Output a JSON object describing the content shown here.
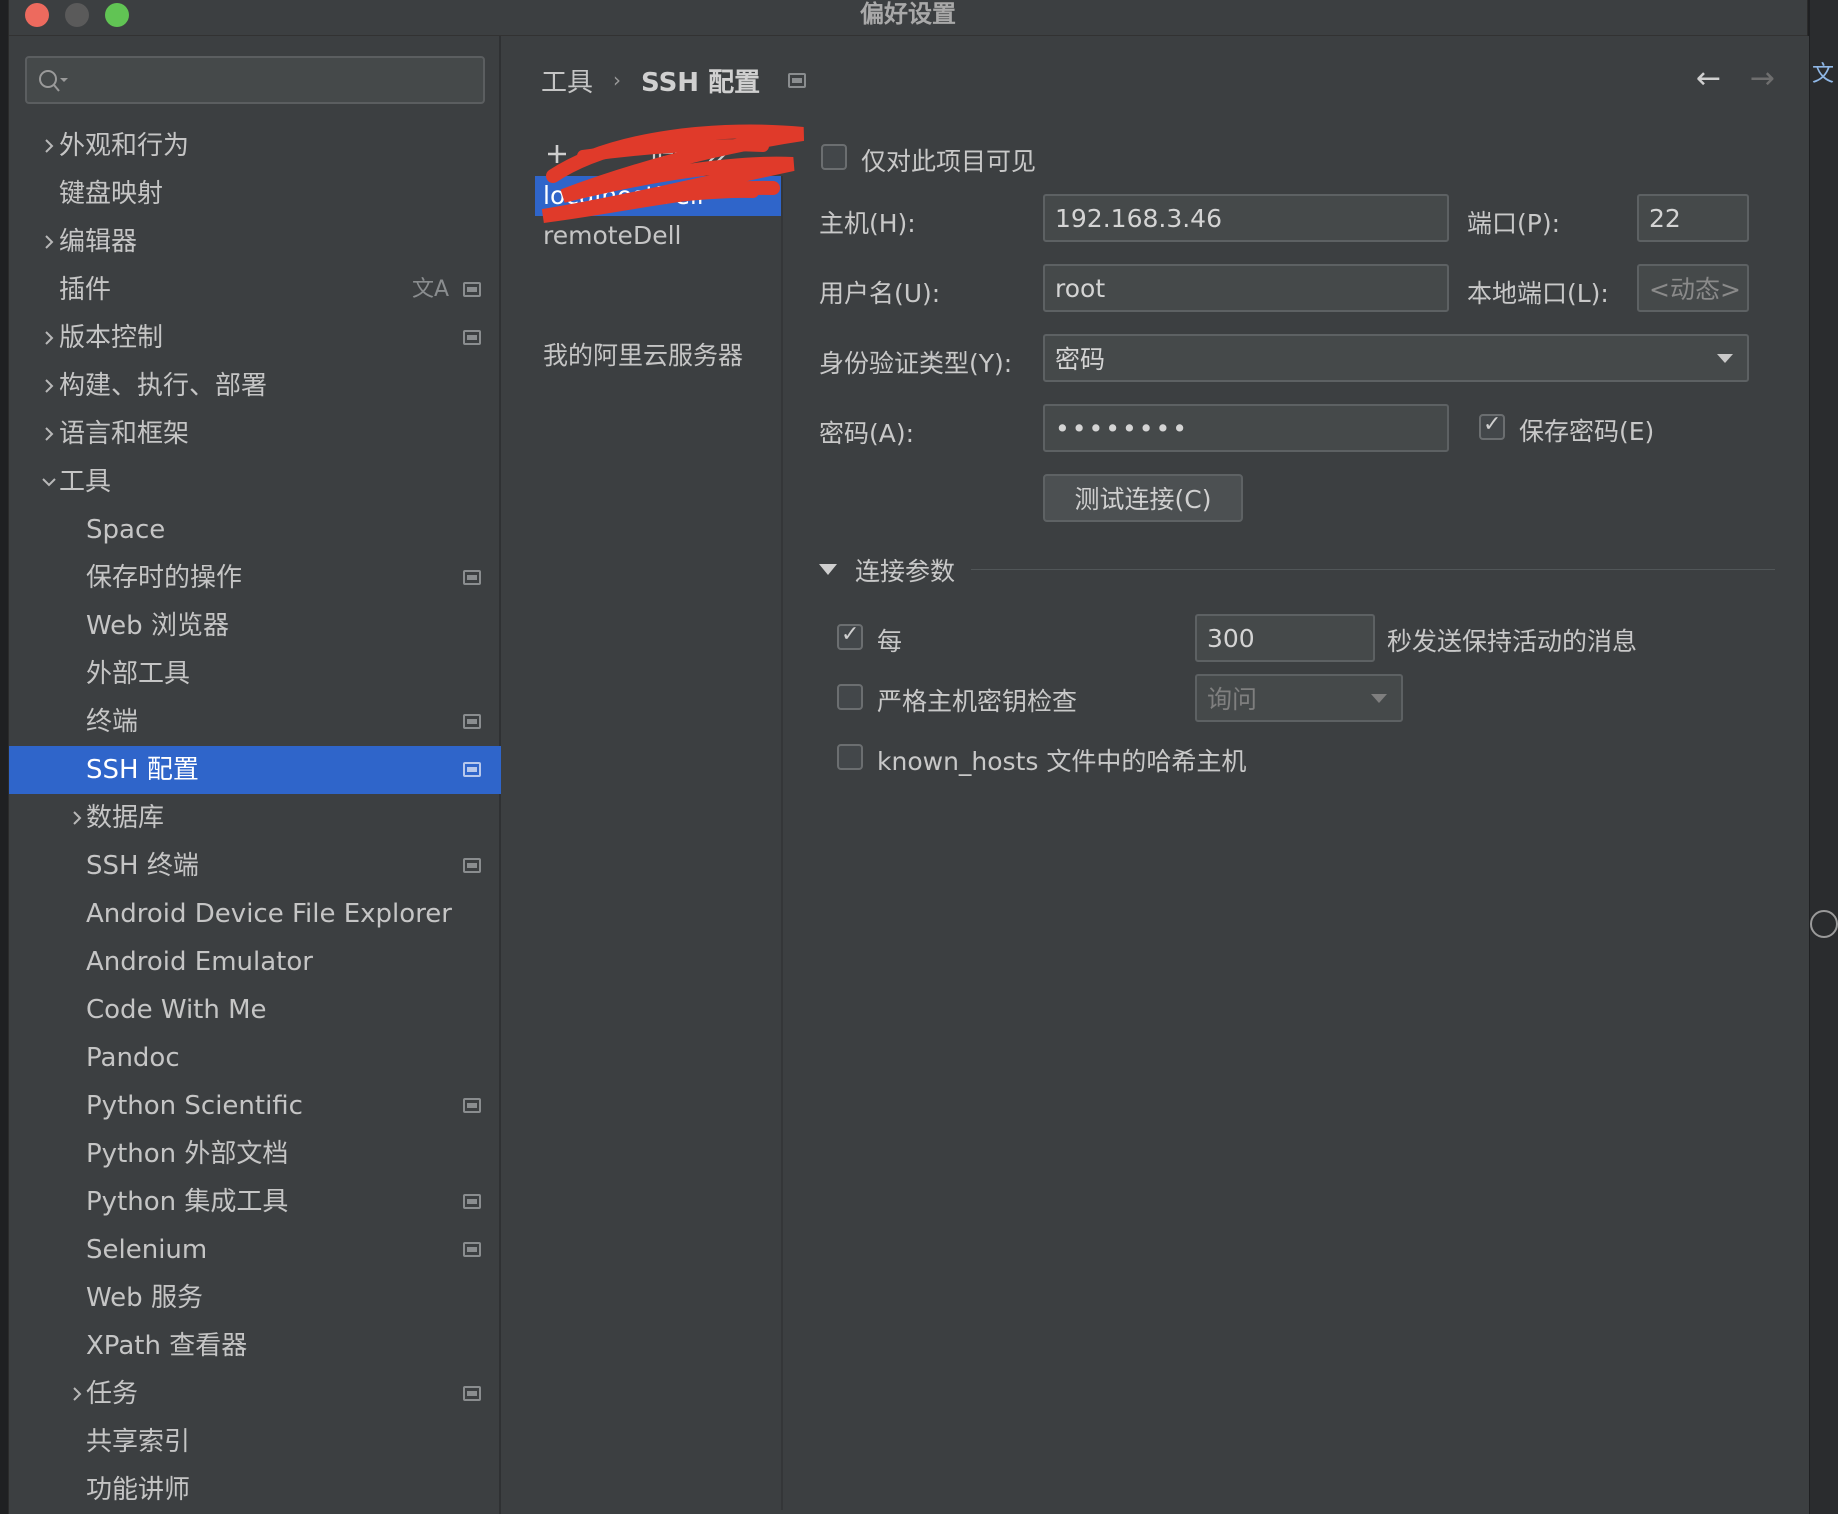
{
  "window": {
    "title": "偏好设置"
  },
  "search": {
    "placeholder": ""
  },
  "sidebar": {
    "items": [
      {
        "label": "外观和行为",
        "expandable": true,
        "expanded": false,
        "level": 0,
        "badge": false
      },
      {
        "label": "键盘映射",
        "expandable": false,
        "level": 0,
        "badge": false
      },
      {
        "label": "编辑器",
        "expandable": true,
        "expanded": false,
        "level": 0,
        "badge": false
      },
      {
        "label": "插件",
        "expandable": false,
        "level": 0,
        "badge": true,
        "translate": true
      },
      {
        "label": "版本控制",
        "expandable": true,
        "expanded": false,
        "level": 0,
        "badge": true
      },
      {
        "label": "构建、执行、部署",
        "expandable": true,
        "expanded": false,
        "level": 0,
        "badge": false
      },
      {
        "label": "语言和框架",
        "expandable": true,
        "expanded": false,
        "level": 0,
        "badge": false
      },
      {
        "label": "工具",
        "expandable": true,
        "expanded": true,
        "level": 0,
        "badge": false
      },
      {
        "label": "Space",
        "expandable": false,
        "level": 1,
        "badge": false
      },
      {
        "label": "保存时的操作",
        "expandable": false,
        "level": 1,
        "badge": true
      },
      {
        "label": "Web 浏览器",
        "expandable": false,
        "level": 1,
        "badge": false
      },
      {
        "label": "外部工具",
        "expandable": false,
        "level": 1,
        "badge": false
      },
      {
        "label": "终端",
        "expandable": false,
        "level": 1,
        "badge": true
      },
      {
        "label": "SSH 配置",
        "expandable": false,
        "level": 1,
        "badge": true,
        "selected": true
      },
      {
        "label": "数据库",
        "expandable": true,
        "expanded": false,
        "level": 1,
        "badge": false
      },
      {
        "label": "SSH 终端",
        "expandable": false,
        "level": 1,
        "badge": true
      },
      {
        "label": "Android Device File Explorer",
        "expandable": false,
        "level": 1,
        "badge": false
      },
      {
        "label": "Android Emulator",
        "expandable": false,
        "level": 1,
        "badge": false
      },
      {
        "label": "Code With Me",
        "expandable": false,
        "level": 1,
        "badge": false
      },
      {
        "label": "Pandoc",
        "expandable": false,
        "level": 1,
        "badge": false
      },
      {
        "label": "Python Scientific",
        "expandable": false,
        "level": 1,
        "badge": true
      },
      {
        "label": "Python 外部文档",
        "expandable": false,
        "level": 1,
        "badge": false
      },
      {
        "label": "Python 集成工具",
        "expandable": false,
        "level": 1,
        "badge": true
      },
      {
        "label": "Selenium",
        "expandable": false,
        "level": 1,
        "badge": true
      },
      {
        "label": "Web 服务",
        "expandable": false,
        "level": 1,
        "badge": false
      },
      {
        "label": "XPath 查看器",
        "expandable": false,
        "level": 1,
        "badge": false
      },
      {
        "label": "任务",
        "expandable": true,
        "expanded": false,
        "level": 1,
        "badge": true
      },
      {
        "label": "共享索引",
        "expandable": false,
        "level": 1,
        "badge": false
      },
      {
        "label": "功能讲师",
        "expandable": false,
        "level": 1,
        "badge": false
      }
    ]
  },
  "breadcrumb": {
    "parent": "工具",
    "separator": "›",
    "current": "SSH 配置"
  },
  "nav": {
    "back": "←",
    "forward": "→"
  },
  "toolbar": {
    "add": "+",
    "remove": "−"
  },
  "configs": [
    {
      "label": "localhostDell",
      "selected": true
    },
    {
      "label": "remoteDell",
      "selected": false
    },
    {
      "label": "",
      "selected": false
    },
    {
      "label": "",
      "selected": false
    },
    {
      "label": "我的阿里云服务器",
      "selected": false
    }
  ],
  "form": {
    "project_only_label": "仅对此项目可见",
    "project_only_checked": false,
    "host_label": "主机(H):",
    "host_value": "192.168.3.46",
    "port_label": "端口(P):",
    "port_value": "22",
    "user_label": "用户名(U):",
    "user_value": "root",
    "local_port_label": "本地端口(L):",
    "local_port_value": "<动态>",
    "auth_label": "身份验证类型(Y):",
    "auth_value": "密码",
    "password_label": "密码(A):",
    "password_value": "••••••••",
    "save_password_label": "保存密码(E)",
    "save_password_checked": true,
    "test_button": "测试连接(C)",
    "section_title": "连接参数",
    "keepalive_label": "每",
    "keepalive_checked": true,
    "keepalive_value": "300",
    "keepalive_suffix": "秒发送保持活动的消息",
    "strict_label": "严格主机密钥检查",
    "strict_checked": false,
    "strict_value": "询问",
    "hash_label": "known_hosts 文件中的哈希主机",
    "hash_checked": false
  },
  "colors": {
    "accent": "#2f65ca",
    "background": "#3c3f41",
    "field": "#45494a"
  }
}
